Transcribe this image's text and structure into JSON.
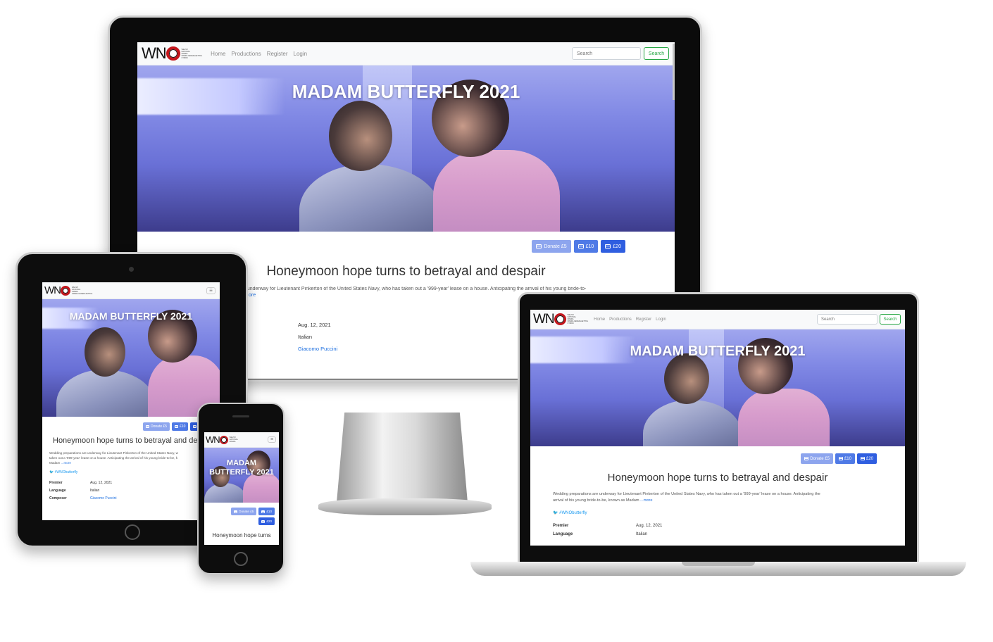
{
  "site": {
    "logo_text": "WN",
    "logo_subtitle": [
      "WELSH",
      "NATIONAL",
      "OPERA",
      "OPERA CENEDLAETHOL",
      "CYMRU"
    ],
    "nav_links": [
      "Home",
      "Productions",
      "Register",
      "Login"
    ],
    "search_placeholder": "Search",
    "search_button": "Search"
  },
  "production": {
    "title": "MADAM BUTTERFLY 2021",
    "title_line1": "MADAM",
    "title_line2": "BUTTERFLY 2021",
    "donate_buttons": [
      "Donate £5",
      "£10",
      "£20"
    ],
    "headline": "Honeymoon hope turns to betrayal and despair",
    "headline_truncated_tablet": "Honeymoon hope turns to betrayal and desp",
    "headline_phone": "Honeymoon hope turns",
    "description": "Wedding preparations are underway for Lieutenant Pinkerton of the United States Navy, who has taken out a '999-year' lease on a house. Anticipating the arrival of his young bride-to-be, known as Madam",
    "description_desktop_visible": "e underway for Lieutenant Pinkerton of the United States Navy, who has taken out a '999-year' lease on a house. Anticipating the arrival of his young bride-to-",
    "description_tablet_l1": "Wedding preparations are underway for Lieutenant Pinkerton of the United States Navy, w",
    "description_tablet_l2": "taken out a '999-year' lease on a house. Anticipating the arrival of his young bride-to-be, k",
    "description_tablet_l3": "Madam",
    "description_laptop_l1": "Wedding preparations are underway for Lieutenant Pinkerton of the United States Navy, who has taken out a '999-year' lease on a house. Anticipating the",
    "description_laptop_l2": "arrival of his young bride-to-be, known as Madam",
    "more_link": "...more",
    "more_link_desktop": "ore",
    "hashtag": "#WNObutterfly",
    "meta": [
      {
        "label": "Premier",
        "value": "Aug. 12, 2021"
      },
      {
        "label": "Language",
        "value": "Italian"
      },
      {
        "label": "Composer",
        "value": "Giacomo Puccini"
      }
    ]
  },
  "colors": {
    "accent": "#2f5ee0",
    "search_green": "#28a745",
    "logo_red": "#c4161c"
  }
}
